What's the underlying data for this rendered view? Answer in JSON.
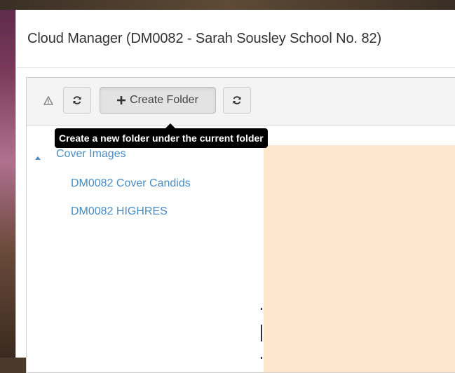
{
  "modal": {
    "title": "Cloud Manager (DM0082 - Sarah Sousley School No. 82)"
  },
  "toolbar": {
    "buttons": [
      {
        "name": "warning-icon",
        "label": ""
      },
      {
        "name": "refresh-icon",
        "label": ""
      },
      {
        "name": "plus-icon",
        "label": "Create Folder"
      },
      {
        "name": "refresh-icon",
        "label": ""
      }
    ],
    "tooltip": "Create a new folder under the current folder"
  },
  "tree": {
    "root": {
      "label": "Cover Images",
      "expanded": true
    },
    "children": [
      {
        "label": "DM0082 Cover Candids"
      },
      {
        "label": "DM0082 HIGHRES"
      }
    ]
  },
  "colors": {
    "link": "#4a8cc4",
    "content_bg": "#fde7cc",
    "tooltip_bg": "#000000"
  }
}
